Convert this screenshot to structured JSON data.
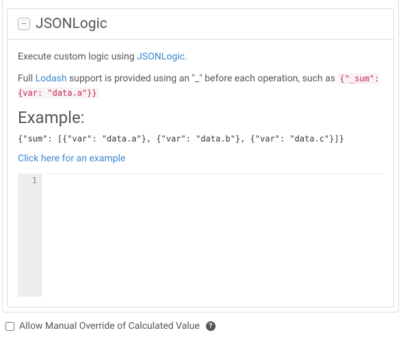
{
  "panel": {
    "toggle_glyph": "−",
    "title": "JSONLogic",
    "intro_prefix": "Execute custom logic using ",
    "intro_link": "JSONLogic",
    "intro_suffix": ".",
    "lodash_prefix": "Full ",
    "lodash_link": "Lodash",
    "lodash_mid": " support is provided using an \"_\" before each operation, such as ",
    "lodash_code": "{\"_sum\": {var: \"data.a\"}}",
    "example_heading": "Example:",
    "example_code": "{\"sum\": [{\"var\": \"data.a\"}, {\"var\": \"data.b\"}, {\"var\": \"data.c\"}]}",
    "example_link": "Click here for an example",
    "editor": {
      "line_number": "1",
      "content": ""
    }
  },
  "checkbox": {
    "label": "Allow Manual Override of Calculated Value",
    "help_glyph": "?"
  }
}
